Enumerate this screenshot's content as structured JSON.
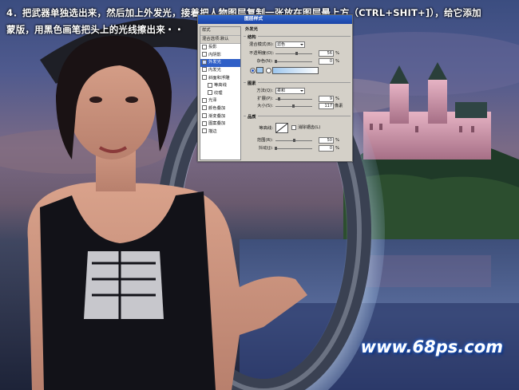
{
  "caption": {
    "line1": "4．把武器单独选出来，然后加上外发光，接着把人物图层复制一张放在图层最上方（CTRL+SHIT+]），给它添加",
    "line2": "蒙版，用黑色画笔把头上的光线擦出来・・"
  },
  "watermark": "www.68ps.com",
  "dialog": {
    "title": "图层样式",
    "styles": [
      {
        "label": "样式",
        "checked": null,
        "header": true
      },
      {
        "label": "混合选项:默认",
        "checked": null,
        "header": true
      },
      {
        "label": "投影",
        "checked": false
      },
      {
        "label": "内阴影",
        "checked": false
      },
      {
        "label": "外发光",
        "checked": true,
        "selected": true
      },
      {
        "label": "内发光",
        "checked": false
      },
      {
        "label": "斜面和浮雕",
        "checked": false
      },
      {
        "label": "等高线",
        "checked": false,
        "sub": true
      },
      {
        "label": "纹理",
        "checked": false,
        "sub": true
      },
      {
        "label": "光泽",
        "checked": false
      },
      {
        "label": "颜色叠加",
        "checked": false
      },
      {
        "label": "渐变叠加",
        "checked": false
      },
      {
        "label": "图案叠加",
        "checked": false
      },
      {
        "label": "描边",
        "checked": false
      }
    ],
    "outer_glow": {
      "title": "外发光",
      "structure": {
        "title": "结构",
        "blend_mode_label": "混合模式(B):",
        "blend_mode_value": "滤色",
        "opacity_label": "不透明度(O):",
        "opacity_value": "56",
        "noise_label": "杂色(N):",
        "noise_value": "0",
        "percent": "%",
        "opacity_level": 0.56,
        "noise_level": 0.0,
        "glow_color": "#9ec7ee"
      },
      "elements": {
        "title": "图素",
        "technique_label": "方法(Q):",
        "technique_value": "柔和",
        "spread_label": "扩展(P):",
        "spread_value": "9",
        "size_label": "大小(S):",
        "size_value": "117",
        "size_unit": "像素",
        "percent": "%",
        "spread_level": 0.09,
        "size_level": 0.47
      },
      "quality": {
        "title": "品质",
        "contour_label": "等高线:",
        "antialias_label": "消除锯齿(L)",
        "range_label": "范围(R):",
        "range_value": "50",
        "jitter_label": "抖动(J):",
        "jitter_value": "0",
        "percent": "%",
        "range_level": 0.5,
        "jitter_level": 0.0
      }
    }
  }
}
